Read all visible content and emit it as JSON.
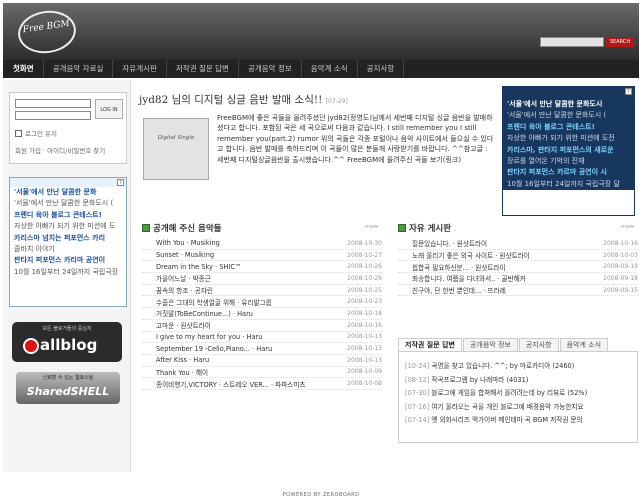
{
  "header": {
    "logo_text": "Free BGM",
    "search_button": "SEARCH"
  },
  "nav": {
    "items": [
      "첫화면",
      "공개음악 자료실",
      "자유게시판",
      "저작권 질문 답변",
      "공개음악 정보",
      "음악계 소식",
      "공지사항"
    ]
  },
  "login": {
    "button": "LOG IN",
    "remember": "로그인 유지",
    "join": "회원 가입 · 아이디/비밀번호 찾기"
  },
  "left_promo": {
    "lines": [
      "'서울'에서 만난 달콤한 문화",
      "'서울'에서 만난 달콤한 문화도시 (",
      "프렌디 육아 블로그 콘테스트!",
      "자상한 아빠가 되기 위한 미션에 도",
      "카리스마 넘치는 퍼포먼스 카리",
      "즐바치 이야기",
      "판타지 퍼포먼스 카리마 공연이",
      "10월 16일부터 24일까지 국립극장"
    ]
  },
  "badges": {
    "allblog_small": "모든 블로거들의 중심지",
    "allblog_big": "allblog",
    "shared_small": "신뢰할 수 있는 웹호스팅",
    "shared_big": "SharedSHELL"
  },
  "post": {
    "title": "jyd82 님의 디지털 싱글 음반 발매 소식!!",
    "date": "[07-29]",
    "thumb_text": "Digital Single",
    "body": "FreeBGM에 좋은 곡들을 올려주셨던 jyd82(정영도)님께서 세번째 디지털 싱글 음반을 발매하셨다고 합니다. 포함된 곡은 세 곡으로써 다음과 같습니다. I still remember you I still remember you(part.2) rumor 위의 곡들은 각종 포털이나 음악 사이트에서 들으실 수 있다고 합니다. 음반 발매를 축하드리며 이 곡들이 많은 분들께 사랑받기를 바랍니다. ^^참고글 : 세번째 디지털싱글음반을 출시했습니다.^^ FreeBGM에 올려주신 곡들 보기(링크)"
  },
  "right_promo": {
    "lines": [
      "'서울'에서 만난 달콤한 문화도시",
      "'서울'에서 만난 달콤한 문화도시 (",
      "프렌디 육아 블로그 콘테스트!",
      "자상한 아빠가 되기 위한 미션에 도전",
      "카리스마, 판타지 퍼포먼스의 새로운",
      "장르를 열어온 기억의 진재",
      "판타지 퍼포먼스 카르마 공연이 시",
      "10월 16일부터 24일까지 국립극장 달"
    ]
  },
  "music_board": {
    "title": "공개해 주신 음악들",
    "more": "more",
    "rows": [
      {
        "title": "With You · Musiking",
        "date": "2008-10-30"
      },
      {
        "title": "Sunset · Musiking",
        "date": "2008-10-27"
      },
      {
        "title": "Dream in the Sky · SHIC™",
        "date": "2008-10-26"
      },
      {
        "title": "가을어느날 · 박종근",
        "date": "2008-10-26"
      },
      {
        "title": "꿈속의 항조 · 공쟈린",
        "date": "2008-10-25"
      },
      {
        "title": "수줍은 그대의 학생얼굴 위해 · 유리발그룹",
        "date": "2008-10-23"
      },
      {
        "title": "거짓말(ToBeContinue...) · Haru",
        "date": "2008-10-18"
      },
      {
        "title": "고마운 · 원샷트라이",
        "date": "2008-10-16"
      },
      {
        "title": "I give to my heart for you · Haru",
        "date": "2008-10-13"
      },
      {
        "title": "September 19 -Cello,Piano... · Haru",
        "date": "2008-10-13"
      },
      {
        "title": "After Kiss · Haru",
        "date": "2008-10-13"
      },
      {
        "title": "Thank You · 해이",
        "date": "2008-10-09"
      },
      {
        "title": "종이비행기,VICTORY · 스트레오 VER... · 파파스미츠",
        "date": "2008-10-08"
      }
    ]
  },
  "free_board": {
    "title": "자유 게시판",
    "more": "more",
    "rows": [
      {
        "title": "질문있습니다. · 원샷트라이",
        "date": "2008-10-16"
      },
      {
        "title": "노래 올리기 좋은 외국 사이트 · 원샷트라이",
        "date": "2008-10-03"
      },
      {
        "title": "힙합곡 필요하신분... · 원샷트라이",
        "date": "2008-09-19"
      },
      {
        "title": "죄송합니다. 여쭙을 다녀와서.. · 골반해커",
        "date": "2008-09-18"
      },
      {
        "title": "친구야, 단 한번 뿐인데... · 뜨라레",
        "date": "2008-09-15"
      }
    ]
  },
  "qa": {
    "tabs": [
      "저작권 질문 답변",
      "공개음악 정보",
      "공지사항",
      "음악계 소식"
    ],
    "rows": [
      {
        "date": "[10-24]",
        "text": "곡명을 찾고 있습니다. ^^; by 마로카디아 (2460)"
      },
      {
        "date": "[08-12]",
        "text": "작곡프로그램 by 나래마라 (4031)"
      },
      {
        "date": "[07-30]",
        "text": "블로그에 게임을 합쳐해서 올려려는데 by 리뷰로 (52%)"
      },
      {
        "date": "[07-16]",
        "text": "여기 올라오는 곡을 개인 블로그에 배경음악 가능한지요"
      },
      {
        "date": "[07-14]",
        "text": "옛 외화시리즈 맥가이버 메인테마 곡 BGM 저작권 문의"
      }
    ]
  },
  "footer": {
    "text": "POWERED BY ZEROBOARD"
  }
}
